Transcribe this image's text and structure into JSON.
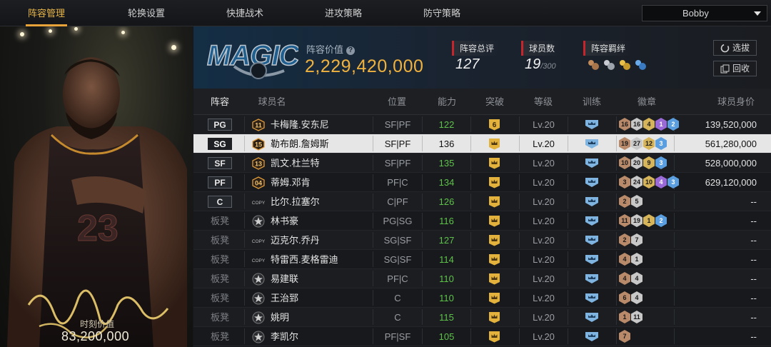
{
  "nav": {
    "tabs": [
      "阵容管理",
      "轮换设置",
      "快捷战术",
      "进攻策略",
      "防守策略"
    ],
    "active": 0,
    "user": "Bobby"
  },
  "player_card": {
    "value_label": "时刻价值",
    "value": "83,200,000"
  },
  "team": {
    "logo_icon": "orlando-magic-logo",
    "value_label": "阵容价值",
    "value": "2,229,420,000",
    "rating_label": "阵容总评",
    "rating": "127",
    "count_label": "球员数",
    "count": "19",
    "count_max": "/300",
    "bond_label": "阵容羁绊",
    "bond_icons": [
      "bond-bronze-icon",
      "bond-silver-icon",
      "bond-gold-icon",
      "bond-blue-icon"
    ],
    "btn_select": "选拔",
    "btn_recycle": "回收"
  },
  "table": {
    "headers": [
      "阵容",
      "球员名",
      "位置",
      "能力",
      "突破",
      "等级",
      "训练",
      "徽章",
      "球员身价"
    ],
    "rows": [
      {
        "slot": "PG",
        "starter": true,
        "badge": "11",
        "name": "卡梅隆.安东尼",
        "pos": "SF|PF",
        "ability": "122",
        "ab_color": "green",
        "brk": "6",
        "level": "Lv.20",
        "badges": [
          [
            "16",
            "bronze"
          ],
          [
            "16",
            "silver"
          ],
          [
            "4",
            "gold"
          ],
          [
            "1",
            "purple"
          ],
          [
            "2",
            "blue"
          ]
        ],
        "salary": "139,520,000"
      },
      {
        "slot": "SG",
        "starter": true,
        "badge": "15",
        "name": "勒布朗.詹姆斯",
        "pos": "SF|PF",
        "ability": "136",
        "ab_color": "white",
        "brk": "crown",
        "level": "Lv.20",
        "badges": [
          [
            "19",
            "bronze"
          ],
          [
            "27",
            "silver"
          ],
          [
            "12",
            "gold"
          ],
          [
            "3",
            "blue"
          ]
        ],
        "salary": "561,280,000",
        "selected": true
      },
      {
        "slot": "SF",
        "starter": true,
        "badge": "13",
        "name": "凯文.杜兰特",
        "pos": "SF|PF",
        "ability": "135",
        "ab_color": "green",
        "brk": "crown",
        "level": "Lv.20",
        "badges": [
          [
            "10",
            "bronze"
          ],
          [
            "20",
            "silver"
          ],
          [
            "9",
            "gold"
          ],
          [
            "3",
            "blue"
          ]
        ],
        "salary": "528,000,000"
      },
      {
        "slot": "PF",
        "starter": true,
        "badge": "04",
        "name": "蒂姆.邓肯",
        "pos": "PF|C",
        "ability": "134",
        "ab_color": "green",
        "brk": "crown",
        "level": "Lv.20",
        "badges": [
          [
            "3",
            "bronze"
          ],
          [
            "24",
            "silver"
          ],
          [
            "10",
            "gold"
          ],
          [
            "4",
            "purple"
          ],
          [
            "3",
            "blue"
          ]
        ],
        "salary": "629,120,000"
      },
      {
        "slot": "C",
        "starter": true,
        "badge": "COPY",
        "name": "比尔.拉塞尔",
        "pos": "C|PF",
        "ability": "126",
        "ab_color": "green",
        "brk": "crown",
        "level": "Lv.20",
        "badges": [
          [
            "2",
            "bronze"
          ],
          [
            "5",
            "silver"
          ]
        ],
        "salary": "--"
      },
      {
        "slot": "板凳",
        "starter": false,
        "badge": "star",
        "name": "林书豪",
        "pos": "PG|SG",
        "ability": "116",
        "ab_color": "green",
        "brk": "crown",
        "level": "Lv.20",
        "badges": [
          [
            "11",
            "bronze"
          ],
          [
            "19",
            "silver"
          ],
          [
            "1",
            "gold"
          ],
          [
            "2",
            "blue"
          ]
        ],
        "salary": "--"
      },
      {
        "slot": "板凳",
        "starter": false,
        "badge": "COPY",
        "name": "迈克尔.乔丹",
        "pos": "SG|SF",
        "ability": "127",
        "ab_color": "green",
        "brk": "crown",
        "level": "Lv.20",
        "badges": [
          [
            "2",
            "bronze"
          ],
          [
            "7",
            "silver"
          ]
        ],
        "salary": "--"
      },
      {
        "slot": "板凳",
        "starter": false,
        "badge": "COPY",
        "name": "特雷西.麦格雷迪",
        "pos": "SG|SF",
        "ability": "114",
        "ab_color": "green",
        "brk": "crown",
        "level": "Lv.20",
        "badges": [
          [
            "4",
            "bronze"
          ],
          [
            "1",
            "silver"
          ]
        ],
        "salary": "--"
      },
      {
        "slot": "板凳",
        "starter": false,
        "badge": "star",
        "name": "易建联",
        "pos": "PF|C",
        "ability": "110",
        "ab_color": "green",
        "brk": "crown",
        "level": "Lv.20",
        "badges": [
          [
            "4",
            "bronze"
          ],
          [
            "4",
            "silver"
          ]
        ],
        "salary": "--"
      },
      {
        "slot": "板凳",
        "starter": false,
        "badge": "star",
        "name": "王治郅",
        "pos": "C",
        "ability": "110",
        "ab_color": "green",
        "brk": "crown",
        "level": "Lv.20",
        "badges": [
          [
            "6",
            "bronze"
          ],
          [
            "4",
            "silver"
          ]
        ],
        "salary": "--"
      },
      {
        "slot": "板凳",
        "starter": false,
        "badge": "star",
        "name": "姚明",
        "pos": "C",
        "ability": "115",
        "ab_color": "green",
        "brk": "crown",
        "level": "Lv.20",
        "badges": [
          [
            "1",
            "bronze"
          ],
          [
            "11",
            "silver"
          ]
        ],
        "salary": "--"
      },
      {
        "slot": "板凳",
        "starter": false,
        "badge": "star",
        "name": "李凯尔",
        "pos": "PF|SF",
        "ability": "105",
        "ab_color": "green",
        "brk": "crown",
        "level": "Lv.20",
        "badges": [
          [
            "7",
            "bronze"
          ]
        ],
        "salary": "--"
      }
    ]
  }
}
